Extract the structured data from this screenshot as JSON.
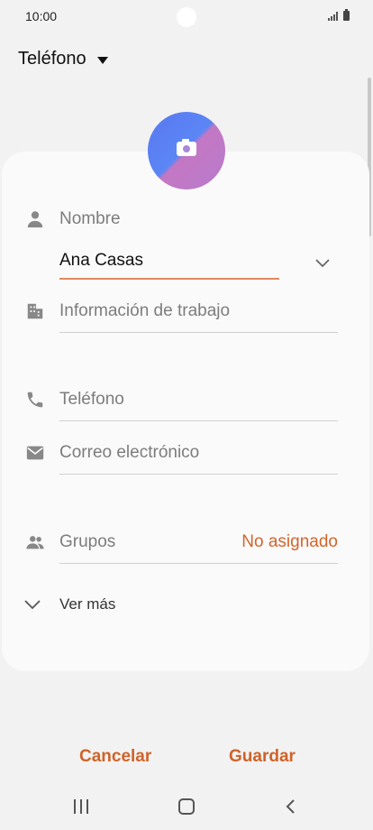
{
  "status_bar": {
    "time": "10:00"
  },
  "header": {
    "account_label": "Teléfono"
  },
  "form": {
    "name_label": "Nombre",
    "name_value": "Ana Casas",
    "work_label": "Información de trabajo",
    "phone_label": "Teléfono",
    "email_label": "Correo electrónico",
    "groups_label": "Grupos",
    "groups_value": "No asignado",
    "more_label": "Ver más"
  },
  "actions": {
    "cancel_label": "Cancelar",
    "save_label": "Guardar"
  },
  "colors": {
    "accent": "#cf6329",
    "background": "#f2f2f2",
    "card": "#fafafa"
  },
  "icons": [
    "camera-icon",
    "person-icon",
    "building-icon",
    "phone-icon",
    "mail-icon",
    "groups-icon",
    "chevron-down-icon",
    "caret-down-icon"
  ]
}
